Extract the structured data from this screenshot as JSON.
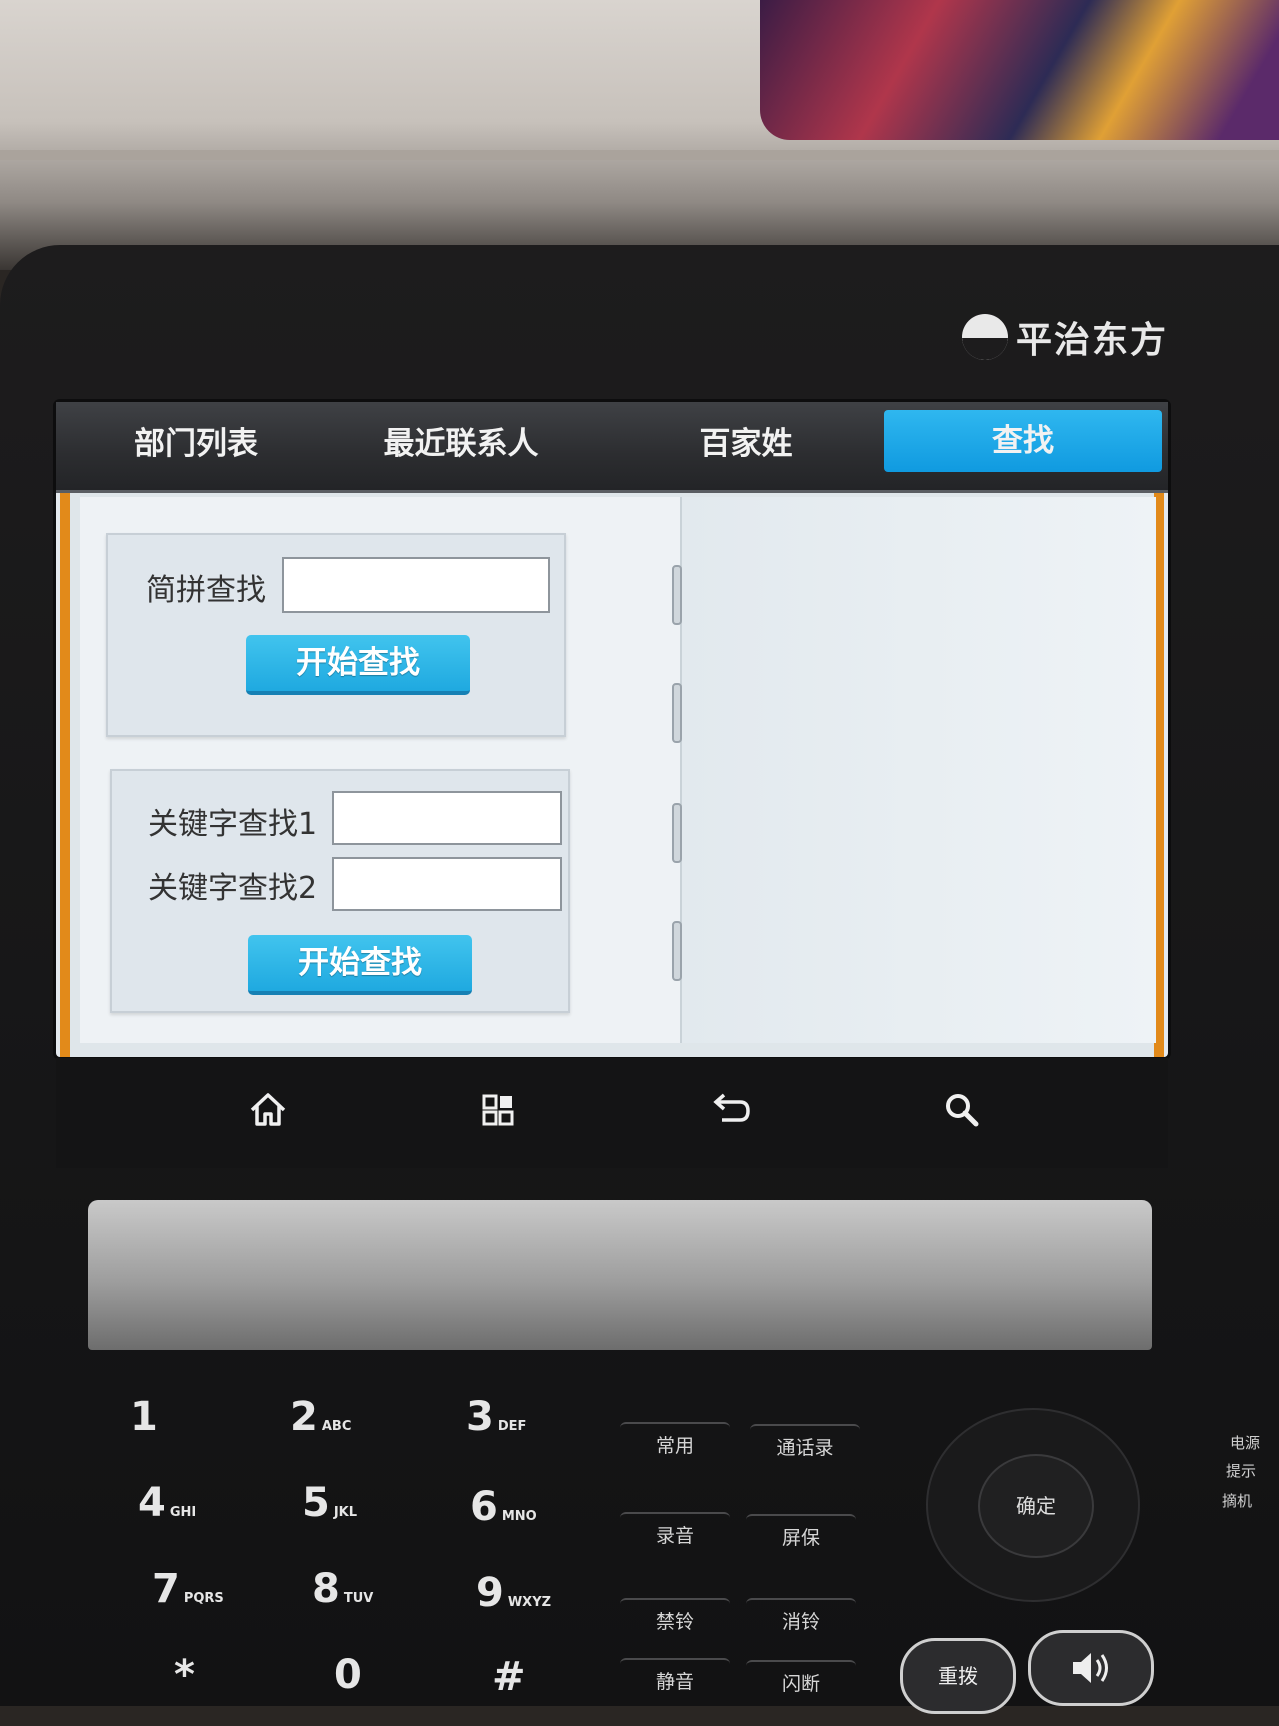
{
  "brand": {
    "name": "平治东方"
  },
  "tabs": [
    {
      "label": "部门列表",
      "active": false
    },
    {
      "label": "最近联系人",
      "active": false
    },
    {
      "label": "百家姓",
      "active": false
    },
    {
      "label": "查找",
      "active": true
    }
  ],
  "pinyin_search": {
    "label": "简拼查找",
    "value": "",
    "button_label": "开始查找"
  },
  "keyword_search": {
    "label1": "关键字查找1",
    "label2": "关键字查找2",
    "value1": "",
    "value2": "",
    "button_label": "开始查找"
  },
  "navbar": {
    "icons": [
      "home-icon",
      "apps-icon",
      "back-icon",
      "search-icon"
    ]
  },
  "keypad": {
    "keys": [
      {
        "digit": "1",
        "letters": ""
      },
      {
        "digit": "2",
        "letters": "ABC"
      },
      {
        "digit": "3",
        "letters": "DEF"
      },
      {
        "digit": "4",
        "letters": "GHI"
      },
      {
        "digit": "5",
        "letters": "JKL"
      },
      {
        "digit": "6",
        "letters": "MNO"
      },
      {
        "digit": "7",
        "letters": "PQRS"
      },
      {
        "digit": "8",
        "letters": "TUV"
      },
      {
        "digit": "9",
        "letters": "WXYZ"
      },
      {
        "digit": "*",
        "letters": ""
      },
      {
        "digit": "0",
        "letters": ""
      },
      {
        "digit": "#",
        "letters": ""
      }
    ],
    "function_keys": [
      "常用",
      "通话录",
      "录音",
      "屏保",
      "禁铃",
      "消铃",
      "静音",
      "闪断"
    ],
    "ok_label": "确定",
    "redial_label": "重拨",
    "side_labels": [
      "电源",
      "提示",
      "摘机"
    ]
  },
  "colors": {
    "accent": "#1aa2e6",
    "frame_orange": "#e28a1a",
    "tabbar": "#2c2d30"
  }
}
